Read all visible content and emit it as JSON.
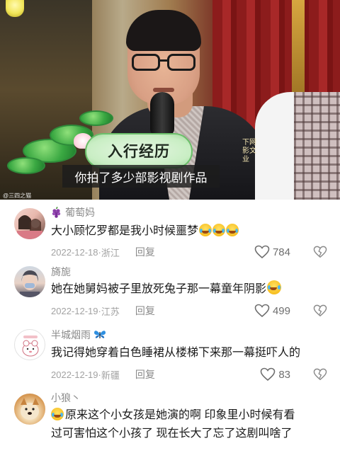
{
  "video": {
    "title_card": "入行经历",
    "subtitle": "你拍了多少部影视剧作品",
    "side_text": "下网影文业",
    "watermark": "@三四之猫"
  },
  "comments": [
    {
      "username": "葡萄妈",
      "username_icon": "grape-icon",
      "text": "大小顾忆罗都是我小时候噩梦",
      "trailing_emojis": [
        "crying-laughing-emoji",
        "crying-laughing-emoji",
        "crying-laughing-emoji"
      ],
      "date": "2022-12-18",
      "location": "浙江",
      "reply_label": "回复",
      "likes": "784"
    },
    {
      "username": "旖旎",
      "text": "她在她舅妈被子里放死兔子那一幕童年阴影",
      "trailing_emojis": [
        "crying-face-emoji"
      ],
      "date": "2022-12-19",
      "location": "江苏",
      "reply_label": "回复",
      "likes": "499"
    },
    {
      "username": "半城烟雨",
      "username_icon": "butterfly-icon",
      "text": "我记得她穿着白色睡裙从楼梯下来那一幕挺吓人的",
      "date": "2022-12-19",
      "location": "新疆",
      "reply_label": "回复",
      "likes": "83"
    },
    {
      "username": "小狼丶",
      "leading_emoji": "crying-face-emoji",
      "text_line1": "原来这个小女孩是她演的啊 印象里小时候有看",
      "text_line2": "过可害怕这个小孩了 现在长大了忘了这剧叫啥了"
    }
  ],
  "colors": {
    "username": "#8a8a8a",
    "meta": "#a2a2a2",
    "body": "#1a1a1a",
    "title_card": "#c9eec4"
  }
}
